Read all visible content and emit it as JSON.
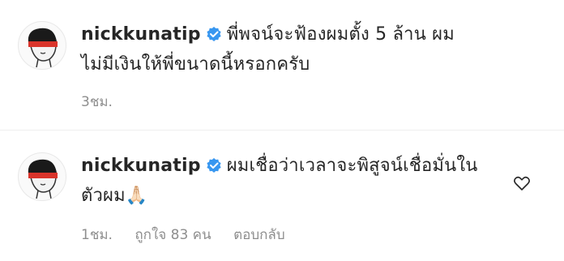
{
  "comments": [
    {
      "username": "nickkunatip",
      "text": "พี่พจน์จะฟ้องผมตั้ง 5 ล้าน ผมไม่มีเงินให้พี่ขนาดนี้หรอกครับ",
      "time": "3ชม."
    },
    {
      "username": "nickkunatip",
      "text": "ผมเชื่อว่าเวลาจะพิสูจน์เชื่อมั่นในตัวผม",
      "emoji": "🙏🏻",
      "time": "1ชม.",
      "likes": "ถูกใจ 83 คน",
      "reply": "ตอบกลับ"
    }
  ],
  "colors": {
    "verified": "#3897f0",
    "muted": "#8e8e8e",
    "text": "#262626"
  }
}
